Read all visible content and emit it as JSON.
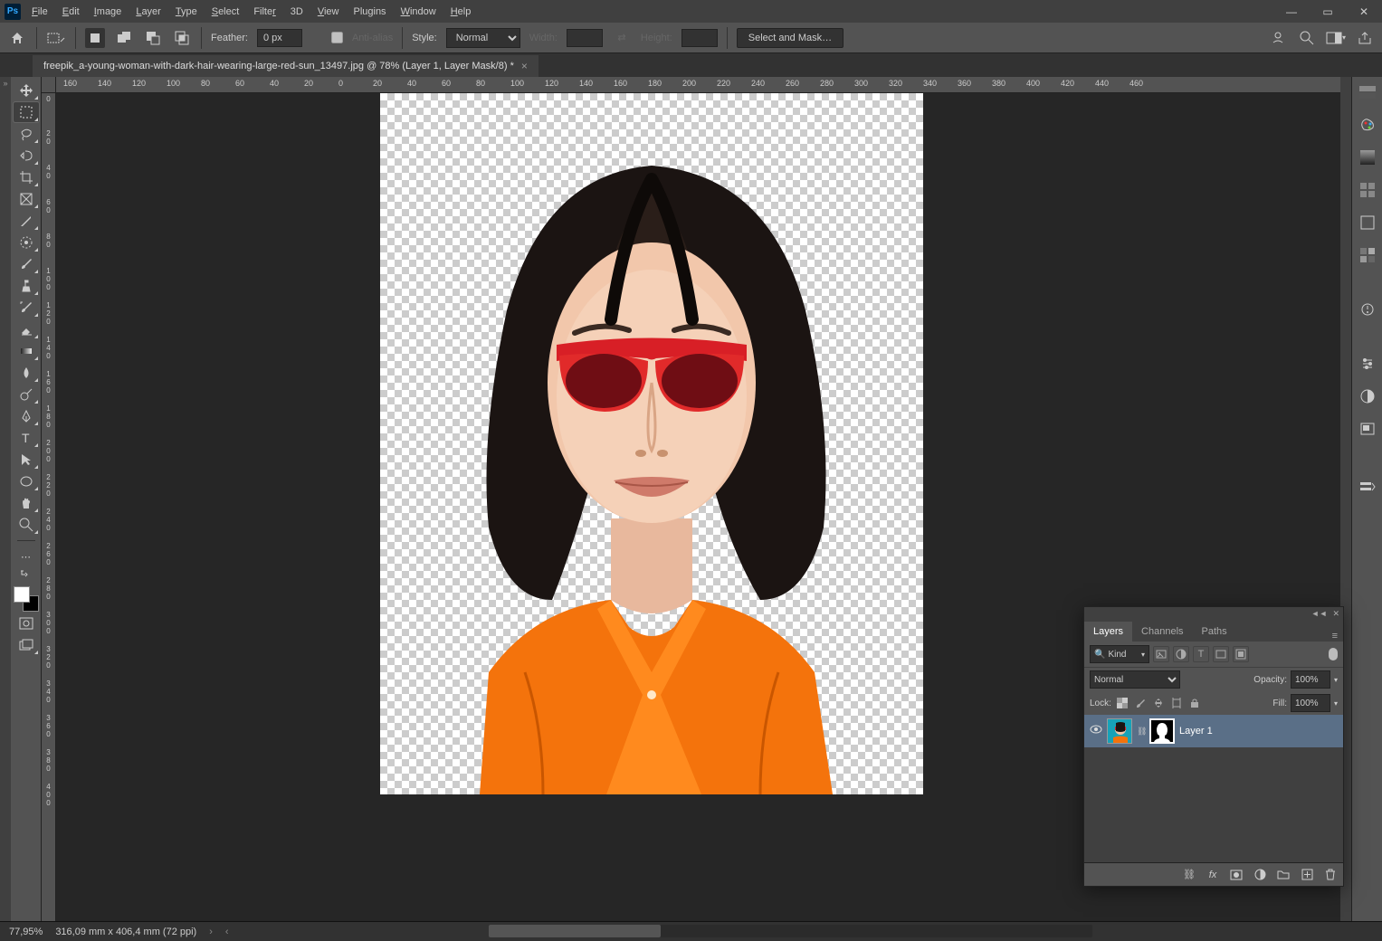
{
  "menu": {
    "file": "File",
    "edit": "Edit",
    "image": "Image",
    "layer": "Layer",
    "type": "Type",
    "select": "Select",
    "filter": "Filter",
    "threeD": "3D",
    "view": "View",
    "plugins": "Plugins",
    "window": "Window",
    "help": "Help"
  },
  "options": {
    "feather_label": "Feather:",
    "feather_value": "0 px",
    "antialias": "Anti-alias",
    "style_label": "Style:",
    "style_value": "Normal",
    "width_label": "Width:",
    "width_value": "",
    "height_label": "Height:",
    "height_value": "",
    "select_mask": "Select and Mask…"
  },
  "doc_tab": "freepik_a-young-woman-with-dark-hair-wearing-large-red-sun_13497.jpg @ 78% (Layer 1, Layer Mask/8) *",
  "ruler_h": [
    "160",
    "140",
    "120",
    "100",
    "80",
    "60",
    "40",
    "20",
    "0",
    "20",
    "40",
    "60",
    "80",
    "100",
    "120",
    "140",
    "160",
    "180",
    "200",
    "220",
    "240",
    "260",
    "280",
    "300",
    "320",
    "340",
    "360",
    "380",
    "400",
    "420",
    "440",
    "460"
  ],
  "ruler_v": [
    "0",
    "2 0",
    "4 0",
    "6 0",
    "8 0",
    "1 0 0",
    "1 2 0",
    "1 4 0",
    "1 6 0",
    "1 8 0",
    "2 0 0",
    "2 2 0",
    "2 4 0",
    "2 6 0",
    "2 8 0",
    "3 0 0",
    "3 2 0",
    "3 4 0",
    "3 6 0",
    "3 8 0",
    "4 0 0"
  ],
  "layers_panel": {
    "tabs": {
      "layers": "Layers",
      "channels": "Channels",
      "paths": "Paths"
    },
    "kind": "Kind",
    "blend_mode": "Normal",
    "opacity_label": "Opacity:",
    "opacity_value": "100%",
    "lock_label": "Lock:",
    "fill_label": "Fill:",
    "fill_value": "100%",
    "layer_name": "Layer 1"
  },
  "status": {
    "zoom": "77,95%",
    "doc_info": "316,09 mm x 406,4 mm (72 ppi)"
  }
}
